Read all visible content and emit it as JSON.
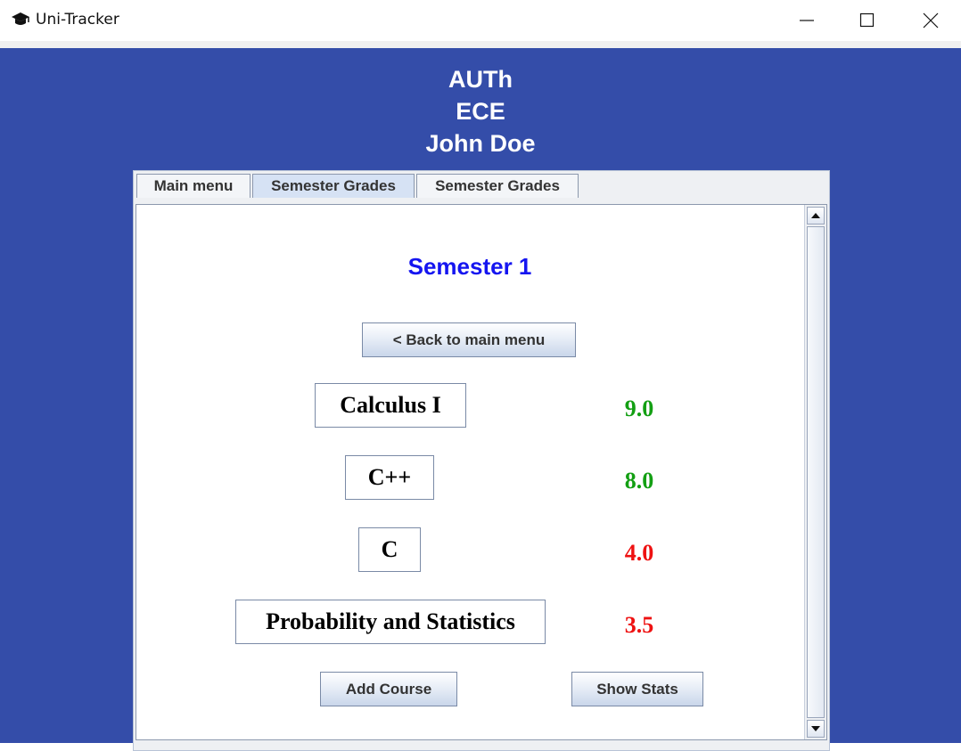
{
  "window": {
    "title": "Uni-Tracker",
    "icon": "graduation-cap-icon"
  },
  "header": {
    "university": "AUTh",
    "department": "ECE",
    "student": "John Doe"
  },
  "tabs": [
    {
      "label": "Main menu",
      "active": false
    },
    {
      "label": "Semester Grades",
      "active": true
    },
    {
      "label": "Semester Grades",
      "active": false
    }
  ],
  "semester": {
    "title": "Semester 1",
    "back_label": "< Back to main menu",
    "courses": [
      {
        "name": "Calculus I",
        "grade": "9.0",
        "status": "pass"
      },
      {
        "name": "C++",
        "grade": "8.0",
        "status": "pass"
      },
      {
        "name": "C",
        "grade": "4.0",
        "status": "fail"
      },
      {
        "name": "Probability and Statistics",
        "grade": "3.5",
        "status": "fail"
      }
    ],
    "add_label": "Add Course",
    "stats_label": "Show Stats"
  },
  "colors": {
    "background": "#344da9",
    "title": "#1515f0",
    "pass": "#139f13",
    "fail": "#ee1111"
  }
}
